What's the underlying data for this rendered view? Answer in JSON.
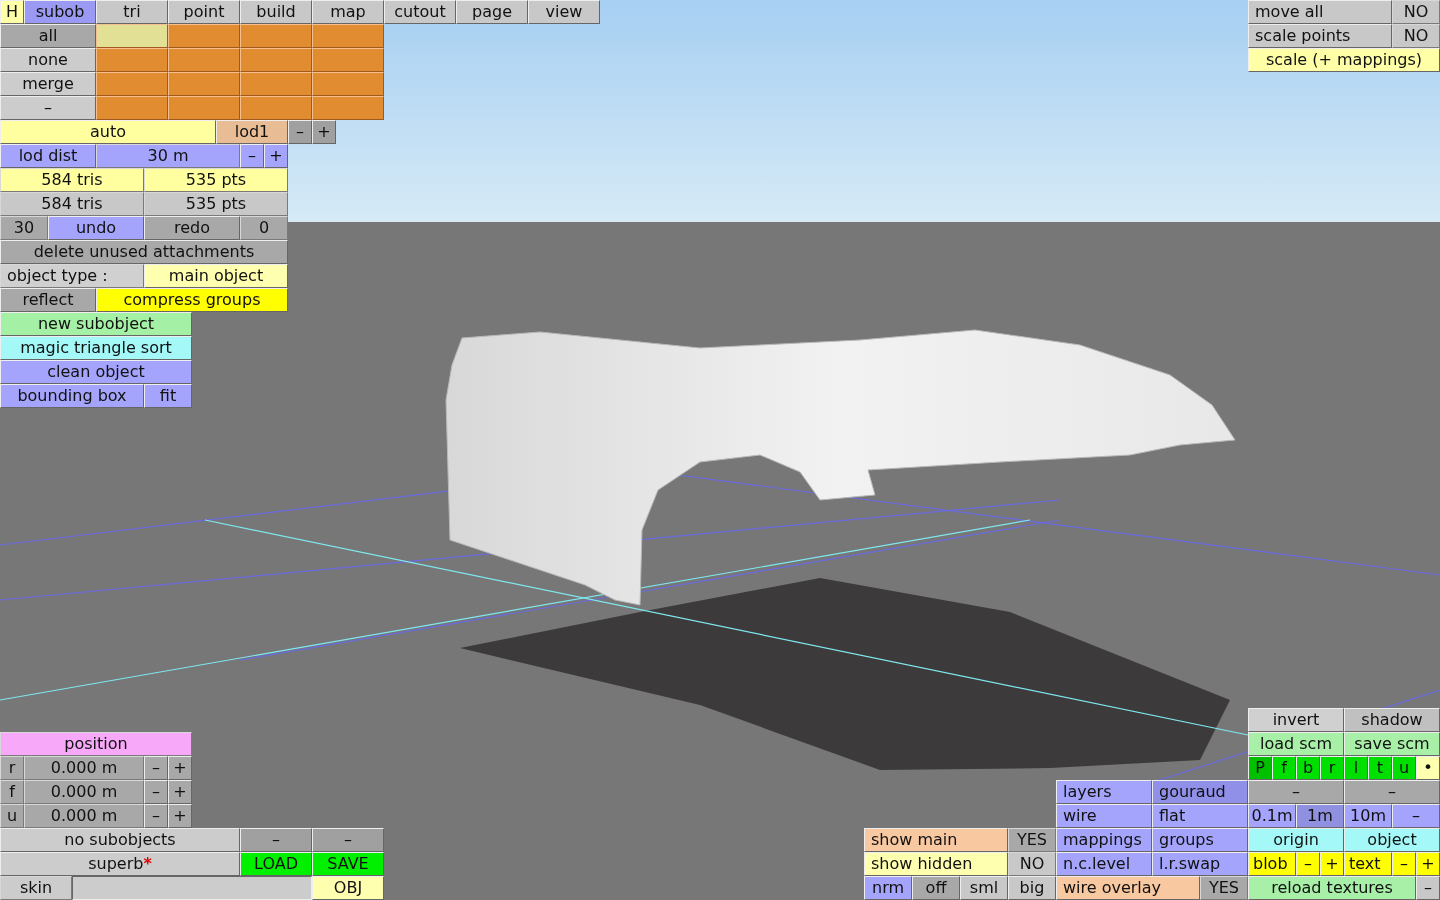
{
  "help_button": {
    "label": "H"
  },
  "tabs": [
    {
      "label": "subob",
      "selected": true
    },
    {
      "label": "tri",
      "selected": false
    },
    {
      "label": "point",
      "selected": false
    },
    {
      "label": "build",
      "selected": false
    },
    {
      "label": "map",
      "selected": false
    },
    {
      "label": "cutout",
      "selected": false
    },
    {
      "label": "page",
      "selected": false
    },
    {
      "label": "view",
      "selected": false
    }
  ],
  "panels": [
    {
      "lines": [
        {
          "controls": [
            {
              "kind": "button",
              "text": "all",
              "color": "#a8a8a8"
            },
            {
              "kind": "swatch",
              "color": "#e2e094"
            },
            {
              "kind": "swatch",
              "color": "#e28c32"
            },
            {
              "kind": "swatch",
              "color": "#e28c32"
            },
            {
              "kind": "swatch",
              "color": "#e28c32"
            }
          ]
        },
        {
          "controls": [
            {
              "kind": "button",
              "text": "none",
              "color": "#cccccc"
            },
            {
              "kind": "swatch",
              "color": "#e28c32"
            },
            {
              "kind": "swatch",
              "color": "#e28c32"
            },
            {
              "kind": "swatch",
              "color": "#e28c32"
            },
            {
              "kind": "swatch",
              "color": "#e28c32"
            }
          ]
        },
        {
          "controls": [
            {
              "kind": "button",
              "text": "merge",
              "color": "#cccccc"
            },
            {
              "kind": "swatch",
              "color": "#e28c32"
            },
            {
              "kind": "swatch",
              "color": "#e28c32"
            },
            {
              "kind": "swatch",
              "color": "#e28c32"
            },
            {
              "kind": "swatch",
              "color": "#e28c32"
            }
          ]
        },
        {
          "controls": [
            {
              "kind": "button",
              "text": "–",
              "color": "#cccccc"
            },
            {
              "kind": "swatch",
              "color": "#e28c32"
            },
            {
              "kind": "swatch",
              "color": "#e28c32"
            },
            {
              "kind": "swatch",
              "color": "#e28c32"
            },
            {
              "kind": "swatch",
              "color": "#e28c32"
            }
          ]
        },
        {
          "controls": [
            {
              "kind": "button",
              "text": "auto",
              "color": "#ffffa0"
            },
            {
              "kind": "button",
              "text": "lod1",
              "color": "#e8bc94"
            },
            {
              "kind": "button",
              "text": "–",
              "color": "#a0a0a0"
            },
            {
              "kind": "button",
              "text": "+",
              "color": "#a0a0a0"
            }
          ]
        },
        {
          "controls": [
            {
              "kind": "button",
              "text": "lod dist",
              "color": "#a4a4fc"
            },
            {
              "kind": "label",
              "text": "30 m",
              "color": "#a4a4fc"
            },
            {
              "kind": "button",
              "text": "–",
              "color": "#a4a4fc"
            },
            {
              "kind": "button",
              "text": "+",
              "color": "#a4a4fc"
            }
          ]
        },
        {
          "controls": [
            {
              "kind": "label",
              "text": "584 tris",
              "color": "#ffffa0"
            },
            {
              "kind": "label",
              "text": "535 pts",
              "color": "#ffffa0"
            }
          ]
        },
        {
          "controls": [
            {
              "kind": "label",
              "text": "584 tris",
              "color": "#c8c8c8"
            },
            {
              "kind": "label",
              "text": "535 pts",
              "color": "#c8c8c8"
            }
          ]
        },
        {
          "controls": [
            {
              "kind": "label",
              "text": "30",
              "color": "#a8a8a8"
            },
            {
              "kind": "button",
              "text": "undo",
              "color": "#a4a4fc"
            },
            {
              "kind": "button",
              "text": "redo",
              "color": "#a8a8a8"
            },
            {
              "kind": "label",
              "text": "0",
              "color": "#a8a8a8"
            }
          ]
        },
        {
          "controls": [
            {
              "kind": "button",
              "text": "delete unused attachments",
              "color": "#a8a8a8"
            }
          ]
        },
        {
          "controls": [
            {
              "kind": "label",
              "text": "object type :",
              "color": "#d0d0d0"
            },
            {
              "kind": "button",
              "text": "main object",
              "color": "#ffffb0"
            }
          ]
        },
        {
          "controls": [
            {
              "kind": "button",
              "text": "reflect",
              "color": "#a8a8a8"
            },
            {
              "kind": "button",
              "text": "compress groups",
              "color": "#ffff00"
            }
          ]
        },
        {
          "controls": [
            {
              "kind": "button",
              "text": "new subobject",
              "color": "#a4f0a4"
            }
          ]
        },
        {
          "controls": [
            {
              "kind": "button",
              "text": "magic triangle sort",
              "color": "#a4f8f8"
            }
          ]
        },
        {
          "controls": [
            {
              "kind": "button",
              "text": "clean object",
              "color": "#a4a4fc"
            }
          ]
        },
        {
          "controls": [
            {
              "kind": "button",
              "text": "bounding box",
              "color": "#a4a4fc"
            },
            {
              "kind": "button",
              "text": "fit",
              "color": "#a4a4fc"
            }
          ]
        }
      ]
    },
    {
      "lines": [
        {
          "controls": [
            {
              "kind": "button",
              "text": "move all",
              "color": "#c8c8c8"
            },
            {
              "kind": "label",
              "text": "NO",
              "color": "#c8c8c8"
            }
          ]
        },
        {
          "controls": [
            {
              "kind": "button",
              "text": "scale points",
              "color": "#c8c8c8"
            },
            {
              "kind": "label",
              "text": "NO",
              "color": "#c8c8c8"
            }
          ]
        },
        {
          "controls": [
            {
              "kind": "button",
              "text": "scale (+ mappings)",
              "color": "#ffffa8"
            }
          ]
        }
      ]
    },
    {
      "lines": [
        {
          "controls": [
            {
              "kind": "label",
              "text": "position",
              "color": "#f8a8f8"
            }
          ]
        },
        {
          "controls": [
            {
              "kind": "label",
              "text": "r",
              "color": "#a8a8a8"
            },
            {
              "kind": "label",
              "text": "0.000 m",
              "color": "#a8a8a8"
            },
            {
              "kind": "button",
              "text": "–",
              "color": "#a8a8a8"
            },
            {
              "kind": "button",
              "text": "+",
              "color": "#a8a8a8"
            }
          ]
        },
        {
          "controls": [
            {
              "kind": "label",
              "text": "f",
              "color": "#a8a8a8"
            },
            {
              "kind": "label",
              "text": "0.000 m",
              "color": "#a8a8a8"
            },
            {
              "kind": "button",
              "text": "–",
              "color": "#a8a8a8"
            },
            {
              "kind": "button",
              "text": "+",
              "color": "#a8a8a8"
            }
          ]
        },
        {
          "controls": [
            {
              "kind": "label",
              "text": "u",
              "color": "#a8a8a8"
            },
            {
              "kind": "label",
              "text": "0.000 m",
              "color": "#a8a8a8"
            },
            {
              "kind": "button",
              "text": "–",
              "color": "#a8a8a8"
            },
            {
              "kind": "button",
              "text": "+",
              "color": "#a8a8a8"
            }
          ]
        },
        {
          "controls": [
            {
              "kind": "button",
              "text": "no subobjects",
              "color": "#cccccc"
            },
            {
              "kind": "button",
              "text": "–",
              "color": "#a0a0a0"
            },
            {
              "kind": "button",
              "text": "–",
              "color": "#a0a0a0"
            }
          ]
        },
        {
          "controls": [
            {
              "kind": "button",
              "text": "superb",
              "mark": "*",
              "color": "#cccccc"
            },
            {
              "kind": "button",
              "text": "LOAD",
              "color": "#00f000"
            },
            {
              "kind": "button",
              "text": "SAVE",
              "color": "#00f000"
            }
          ]
        },
        {
          "controls": [
            {
              "kind": "label",
              "text": "skin",
              "color": "#cccccc"
            },
            {
              "kind": "field",
              "color": "#cccccc"
            },
            {
              "kind": "button",
              "text": "OBJ",
              "color": "#ffffb0"
            }
          ]
        }
      ]
    },
    {
      "lines": [
        {
          "controls": [
            {
              "kind": "button",
              "text": "show main",
              "color": "#f8c8a0"
            },
            {
              "kind": "label",
              "text": "YES",
              "color": "#a8a8a8"
            }
          ]
        },
        {
          "controls": [
            {
              "kind": "button",
              "text": "show hidden",
              "color": "#ffffb0"
            },
            {
              "kind": "label",
              "text": "NO",
              "color": "#c8c8c8"
            }
          ]
        },
        {
          "controls": [
            {
              "kind": "button",
              "text": "nrm",
              "color": "#a4a4fc"
            },
            {
              "kind": "button",
              "text": "off",
              "color": "#a8a8a8"
            },
            {
              "kind": "button",
              "text": "sml",
              "color": "#c8c8c8"
            },
            {
              "kind": "button",
              "text": "big",
              "color": "#c8c8c8"
            }
          ]
        }
      ]
    },
    {
      "lines": [
        {
          "controls": [
            {
              "kind": "button",
              "text": "layers",
              "color": "#a4a4fc"
            },
            {
              "kind": "button",
              "text": "gouraud",
              "color": "#9090e8"
            }
          ]
        },
        {
          "controls": [
            {
              "kind": "button",
              "text": "wire",
              "color": "#a4a4fc"
            },
            {
              "kind": "button",
              "text": "flat",
              "color": "#a4a4fc"
            }
          ]
        },
        {
          "controls": [
            {
              "kind": "button",
              "text": "mappings",
              "color": "#a4a4fc"
            },
            {
              "kind": "button",
              "text": "groups",
              "color": "#a4a4fc"
            }
          ]
        },
        {
          "controls": [
            {
              "kind": "button",
              "text": "n.c.level",
              "color": "#a4a4fc"
            },
            {
              "kind": "button",
              "text": "l.r.swap",
              "color": "#a4a4fc"
            }
          ]
        },
        {
          "controls": [
            {
              "kind": "button",
              "text": "wire overlay",
              "color": "#f8c8a0"
            },
            {
              "kind": "label",
              "text": "YES",
              "color": "#a8a8a8"
            }
          ]
        }
      ]
    },
    {
      "lines": [
        {
          "controls": [
            {
              "kind": "button",
              "text": "invert",
              "color": "#d0d0d0"
            },
            {
              "kind": "button",
              "text": "shadow",
              "color": "#c0c0c0"
            }
          ]
        },
        {
          "controls": [
            {
              "kind": "button",
              "text": "load scm",
              "color": "#a8f0a8"
            },
            {
              "kind": "button",
              "text": "save scm",
              "color": "#a8f0a8"
            }
          ]
        },
        {
          "controls": [
            {
              "kind": "button",
              "text": "P",
              "color": "#00c000"
            },
            {
              "kind": "button",
              "text": "f",
              "color": "#00e000"
            },
            {
              "kind": "button",
              "text": "b",
              "color": "#00e000"
            },
            {
              "kind": "button",
              "text": "r",
              "color": "#00e000"
            },
            {
              "kind": "button",
              "text": "l",
              "color": "#00e000"
            },
            {
              "kind": "button",
              "text": "t",
              "color": "#00e000"
            },
            {
              "kind": "button",
              "text": "u",
              "color": "#00e000"
            },
            {
              "kind": "button",
              "text": "•",
              "color": "#ffffb0"
            }
          ]
        },
        {
          "controls": [
            {
              "kind": "button",
              "text": "–",
              "color": "#a8a8a8"
            },
            {
              "kind": "button",
              "text": "–",
              "color": "#a8a8a8"
            }
          ]
        },
        {
          "controls": [
            {
              "kind": "button",
              "text": "0.1m",
              "color": "#a4a4fc"
            },
            {
              "kind": "button",
              "text": "1m",
              "color": "#9090e0"
            },
            {
              "kind": "button",
              "text": "10m",
              "color": "#a4a4fc"
            },
            {
              "kind": "button",
              "text": "–",
              "color": "#a4a4fc"
            }
          ]
        },
        {
          "controls": [
            {
              "kind": "button",
              "text": "origin",
              "color": "#a4f8f8"
            },
            {
              "kind": "button",
              "text": "object",
              "color": "#a4f8f8"
            }
          ]
        },
        {
          "controls": [
            {
              "kind": "button",
              "text": "blob",
              "color": "#ffff00"
            },
            {
              "kind": "button",
              "text": "–",
              "color": "#ffff00"
            },
            {
              "kind": "button",
              "text": "+",
              "color": "#ffff00"
            },
            {
              "kind": "button",
              "text": "text",
              "color": "#ffff00"
            },
            {
              "kind": "button",
              "text": "–",
              "color": "#ffff00"
            },
            {
              "kind": "button",
              "text": "+",
              "color": "#ffff00"
            }
          ]
        },
        {
          "controls": [
            {
              "kind": "button",
              "text": "reload textures",
              "color": "#a8f0a8"
            },
            {
              "kind": "button",
              "text": "–",
              "color": "#c8c8c8"
            }
          ]
        }
      ]
    }
  ]
}
